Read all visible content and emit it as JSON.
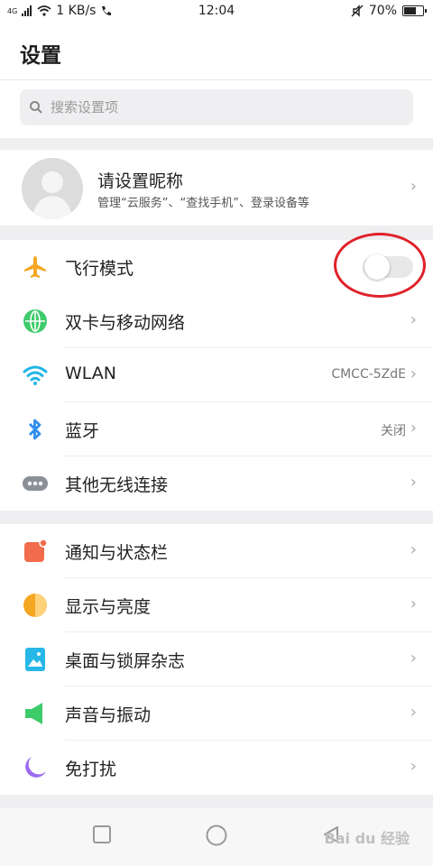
{
  "status_bar": {
    "network": "4G",
    "speed": "1 KB/s",
    "time": "12:04",
    "battery": "70%",
    "battery_level": 0.7
  },
  "header": {
    "title": "设置"
  },
  "search": {
    "placeholder": "搜索设置项"
  },
  "profile": {
    "name": "请设置昵称",
    "subtitle": "管理“云服务”、“查找手机”、登录设备等"
  },
  "wireless": {
    "airplane": {
      "label": "飞行模式",
      "enabled": false
    },
    "dual_sim": {
      "label": "双卡与移动网络"
    },
    "wlan": {
      "label": "WLAN",
      "value": "CMCC-5ZdE"
    },
    "bluetooth": {
      "label": "蓝牙",
      "value": "关闭"
    },
    "other": {
      "label": "其他无线连接"
    }
  },
  "system": {
    "notification": {
      "label": "通知与状态栏"
    },
    "display": {
      "label": "显示与亮度"
    },
    "desktop": {
      "label": "桌面与锁屏杂志"
    },
    "sound": {
      "label": "声音与振动"
    },
    "dnd": {
      "label": "免打扰"
    }
  },
  "watermark": "Bai du 经验",
  "colors": {
    "airplane": "#f5a623",
    "globe": "#3ecb6a",
    "wifi": "#1fb5e6",
    "bluetooth": "#2f8ef0",
    "highlight": "#e0212b"
  }
}
